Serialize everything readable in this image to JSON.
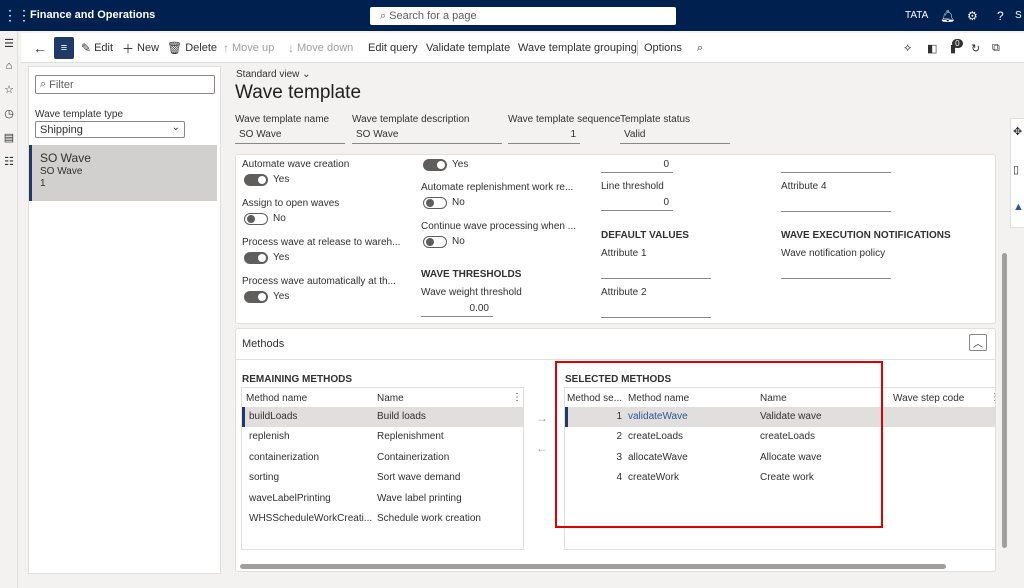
{
  "topbar": {
    "waffle_icon": "waffle-icon",
    "app_title": "Finance and Operations",
    "search_placeholder": "Search for a page",
    "company": "TATA",
    "bell_icon": "bell-icon",
    "gear_icon": "gear-icon",
    "help_icon": "help-icon"
  },
  "actionbar": {
    "back_icon": "back-arrow-icon",
    "edit_label": "Edit",
    "new_label": "New",
    "delete_label": "Delete",
    "move_up_label": "Move up",
    "move_down_label": "Move down",
    "edit_query_label": "Edit query",
    "validate_template_label": "Validate template",
    "wave_template_grouping_label": "Wave template grouping",
    "options_label": "Options",
    "badge_count": "0"
  },
  "left_pane": {
    "filter_placeholder": "Filter",
    "wave_template_type_label": "Wave template type",
    "wave_template_type_value": "Shipping",
    "list_items": [
      {
        "name": "SO Wave",
        "description": "SO Wave",
        "sequence": "1"
      }
    ]
  },
  "header": {
    "view_label": "Standard view",
    "page_title": "Wave template",
    "fields": [
      {
        "label": "Wave template name",
        "value": "SO Wave"
      },
      {
        "label": "Wave template description",
        "value": "SO Wave"
      },
      {
        "label": "Wave template sequence",
        "value": "1"
      },
      {
        "label": "Template status",
        "value": "Valid"
      }
    ]
  },
  "general": {
    "col1": [
      {
        "label": "Automate wave creation",
        "state": "Yes"
      },
      {
        "label": "Assign to open waves",
        "state": "No"
      },
      {
        "label": "Process wave at release to wareh...",
        "state": "Yes"
      },
      {
        "label": "Process wave automatically at th...",
        "state": "Yes"
      }
    ],
    "col2": {
      "first_toggle_state": "Yes",
      "automate_replenishment_label": "Automate replenishment work re...",
      "automate_replenishment_state": "No",
      "continue_wave_label": "Continue wave processing when ...",
      "continue_wave_state": "No",
      "wave_thresholds_header": "WAVE THRESHOLDS",
      "wave_weight_threshold_label": "Wave weight threshold",
      "wave_weight_threshold_value": "0.00"
    },
    "col3": {
      "shipment_value": "0",
      "line_threshold_label": "Line threshold",
      "line_threshold_value": "0",
      "default_values_header": "DEFAULT VALUES",
      "attribute1_label": "Attribute 1",
      "attribute2_label": "Attribute 2"
    },
    "col4": {
      "attribute4_label": "Attribute 4",
      "notifications_header": "WAVE EXECUTION NOTIFICATIONS",
      "notification_policy_label": "Wave notification policy"
    }
  },
  "methods": {
    "section_title": "Methods",
    "remaining": {
      "header": "REMAINING METHODS",
      "columns": [
        "Method name",
        "Name"
      ],
      "rows": [
        {
          "method": "buildLoads",
          "name": "Build loads"
        },
        {
          "method": "replenish",
          "name": "Replenishment"
        },
        {
          "method": "containerization",
          "name": "Containerization"
        },
        {
          "method": "sorting",
          "name": "Sort wave demand"
        },
        {
          "method": "waveLabelPrinting",
          "name": "Wave label printing"
        },
        {
          "method": "WHSScheduleWorkCreati...",
          "name": "Schedule work creation"
        }
      ]
    },
    "selected": {
      "header": "SELECTED METHODS",
      "columns": [
        "Method se...",
        "Method name",
        "Name",
        "Wave step code"
      ],
      "rows": [
        {
          "seq": "1",
          "method": "validateWave",
          "name": "Validate wave"
        },
        {
          "seq": "2",
          "method": "createLoads",
          "name": "createLoads"
        },
        {
          "seq": "3",
          "method": "allocateWave",
          "name": "Allocate wave"
        },
        {
          "seq": "4",
          "method": "createWork",
          "name": "Create work"
        }
      ]
    }
  },
  "colors": {
    "topbar": "#002050",
    "accent": "#1f3a68",
    "link": "#2b5797",
    "highlight_box": "#e00000"
  }
}
